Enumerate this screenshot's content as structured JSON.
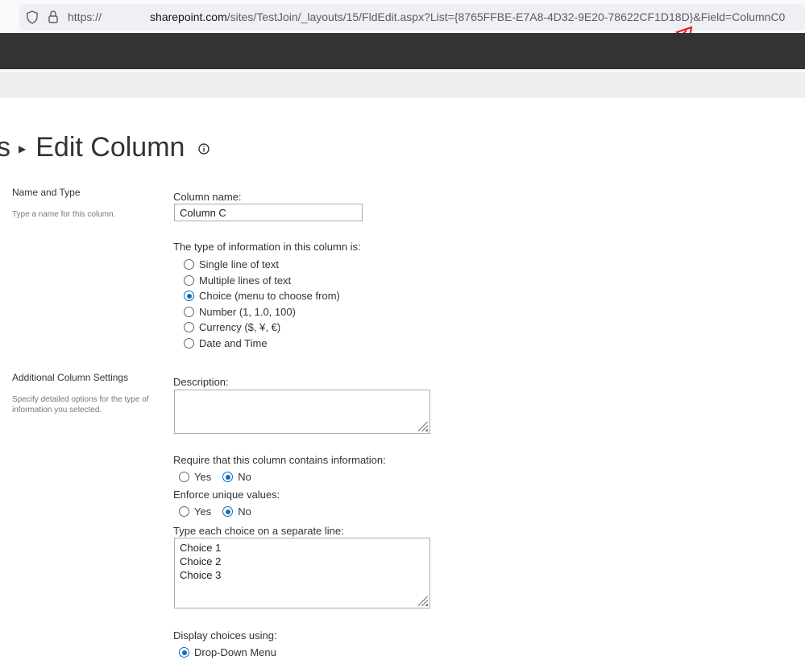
{
  "browser": {
    "url_scheme": "https://",
    "url_host": "sharepoint.com",
    "url_path": "/sites/TestJoin/_layouts/15/FldEdit.aspx?List={8765FFBE-E7A8-4D32-9E20-78622CF1D18D}&Field=ColumnC0",
    "annotation_color": "#e8141c"
  },
  "page": {
    "breadcrumb_prev": "s",
    "title": "Edit Column"
  },
  "name_type": {
    "section_title": "Name and Type",
    "section_desc": "Type a name for this column.",
    "column_name_label": "Column name:",
    "column_name_value": "Column C",
    "type_label": "The type of information in this column is:",
    "types": [
      {
        "label": "Single line of text",
        "selected": false
      },
      {
        "label": "Multiple lines of text",
        "selected": false
      },
      {
        "label": "Choice (menu to choose from)",
        "selected": true
      },
      {
        "label": "Number (1, 1.0, 100)",
        "selected": false
      },
      {
        "label": "Currency ($, ¥, €)",
        "selected": false
      },
      {
        "label": "Date and Time",
        "selected": false
      }
    ]
  },
  "additional": {
    "section_title": "Additional Column Settings",
    "section_desc": "Specify detailed options for the type of information you selected.",
    "description_label": "Description:",
    "description_value": "",
    "require_label": "Require that this column contains information:",
    "enforce_label": "Enforce unique values:",
    "yes": "Yes",
    "no": "No",
    "require_value": "No",
    "enforce_value": "No",
    "choices_label": "Type each choice on a separate line:",
    "choices_value": "Choice 1\nChoice 2\nChoice 3",
    "display_label": "Display choices using:",
    "display_option": "Drop-Down Menu"
  },
  "colors": {
    "accent": "#0f6cbd",
    "suitebar": "#333333"
  }
}
